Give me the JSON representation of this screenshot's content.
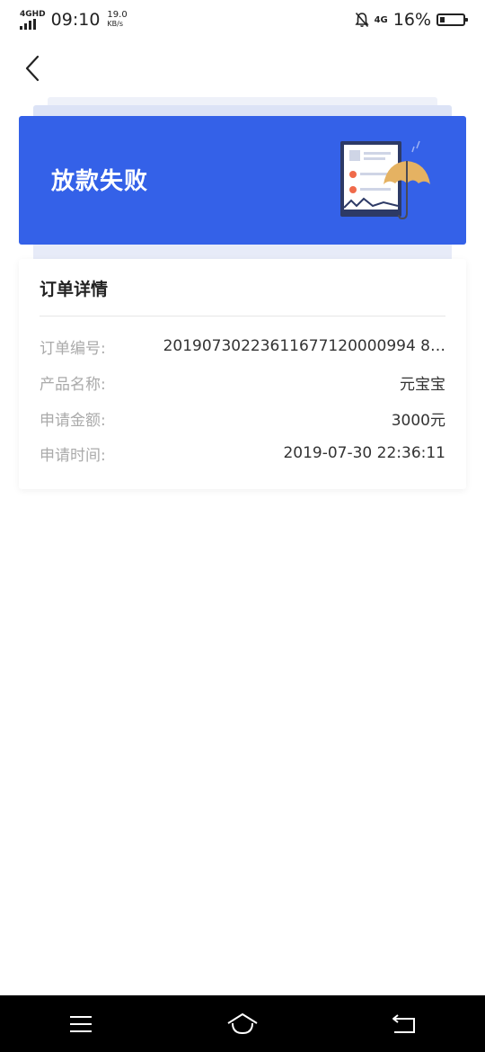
{
  "status_bar": {
    "network_label": "4GHD",
    "time": "09:10",
    "speed_value": "19.0",
    "speed_unit": "KB/s",
    "net_type": "4G",
    "battery": "16%"
  },
  "banner": {
    "title": "放款失败",
    "accent_color": "#3461e8"
  },
  "card": {
    "title": "订单详情",
    "rows": [
      {
        "label": "订单编号:",
        "value": "20190730223611677120000994 8…"
      },
      {
        "label": "产品名称:",
        "value": "元宝宝"
      },
      {
        "label": "申请金额:",
        "value": "3000元"
      },
      {
        "label": "申请时间:",
        "value": "2019-07-30 22:36:11"
      }
    ]
  },
  "icons": {
    "back": "chevron-left-icon",
    "menu": "menu-icon",
    "home": "home-icon",
    "return": "return-icon"
  }
}
